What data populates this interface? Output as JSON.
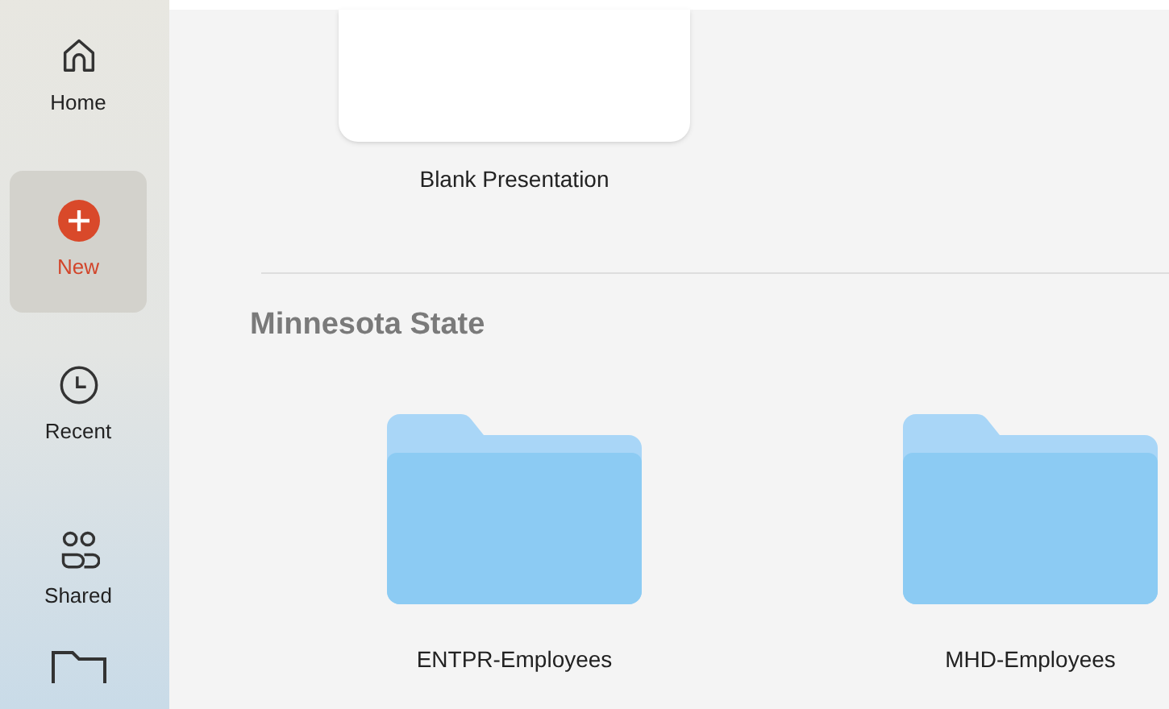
{
  "sidebar": {
    "items": [
      {
        "label": "Home",
        "selected": false
      },
      {
        "label": "New",
        "selected": true
      },
      {
        "label": "Recent",
        "selected": false
      },
      {
        "label": "Shared",
        "selected": false
      }
    ]
  },
  "templates": [
    {
      "label": "Blank Presentation"
    }
  ],
  "section": {
    "title": "Minnesota State",
    "folders": [
      {
        "label": "ENTPR-Employees"
      },
      {
        "label": "MHD-Employees"
      }
    ]
  }
}
